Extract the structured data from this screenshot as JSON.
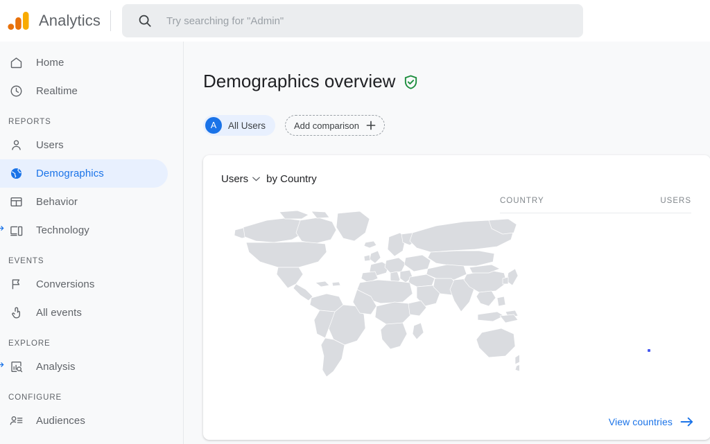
{
  "header": {
    "brand": "Analytics",
    "logo_icon": "google-analytics-logo",
    "search": {
      "icon": "search-icon",
      "placeholder": "Try searching for \"Admin\"",
      "value": ""
    }
  },
  "sidebar": {
    "top_items": [
      {
        "label": "Home",
        "icon": "home-icon",
        "active": false
      },
      {
        "label": "Realtime",
        "icon": "clock-icon",
        "active": false
      }
    ],
    "sections": [
      {
        "title": "REPORTS",
        "items": [
          {
            "label": "Users",
            "icon": "person-icon",
            "active": false
          },
          {
            "label": "Demographics",
            "icon": "globe-icon",
            "active": true
          },
          {
            "label": "Behavior",
            "icon": "layout-icon",
            "active": false
          },
          {
            "label": "Technology",
            "icon": "devices-icon",
            "active": false
          }
        ]
      },
      {
        "title": "EVENTS",
        "items": [
          {
            "label": "Conversions",
            "icon": "flag-icon",
            "active": false
          },
          {
            "label": "All events",
            "icon": "tap-icon",
            "active": false
          }
        ]
      },
      {
        "title": "EXPLORE",
        "items": [
          {
            "label": "Analysis",
            "icon": "analysis-chart-icon",
            "active": false
          }
        ]
      },
      {
        "title": "CONFIGURE",
        "items": [
          {
            "label": "Audiences",
            "icon": "audiences-icon",
            "active": false
          }
        ]
      }
    ]
  },
  "main": {
    "page_title": "Demographics overview",
    "title_badge_icon": "verified-shield-icon",
    "chips": {
      "all_users": {
        "avatar_letter": "A",
        "label": "All Users"
      },
      "add_comparison": {
        "label": "Add comparison",
        "icon": "plus-icon"
      }
    },
    "card": {
      "metric": "Users",
      "metric_caret_icon": "chevron-down-icon",
      "dimension_prefix": "by Country",
      "table": {
        "columns": [
          "COUNTRY",
          "USERS"
        ],
        "rows": []
      },
      "map": {
        "icon": "world-map",
        "fill": "#dadce0",
        "stroke": "#ffffff"
      },
      "footer_link": {
        "label": "View countries",
        "icon": "arrow-right-icon"
      }
    }
  },
  "colors": {
    "accent_blue": "#1a73e8",
    "active_pill": "#e8f0fe",
    "page_bg": "#f8f9fa",
    "card_bg": "#ffffff",
    "text_primary": "#202124",
    "text_secondary": "#5f6368",
    "map_fill": "#dadce0",
    "badge_green": "#1e8e3e",
    "logo_orange": "#f9ab00"
  }
}
